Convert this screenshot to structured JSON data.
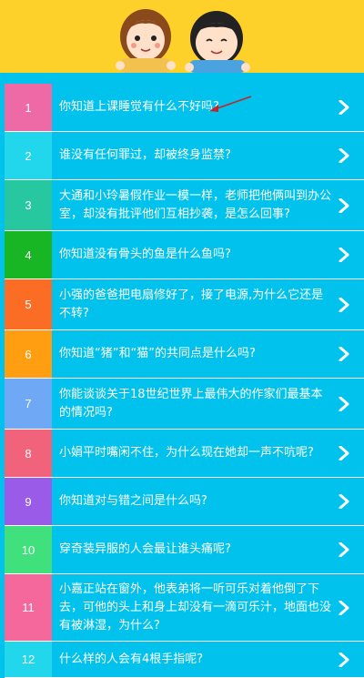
{
  "colors": {
    "background": "#00c2ec",
    "header": "#fdd02a",
    "annotation_arrow": "#c0262a"
  },
  "header": {
    "illustration": "cartoon-girl-and-boy"
  },
  "questions": [
    {
      "num": "1",
      "text": "你知道上课睡觉有什么不好吗?",
      "color": "#ee6aa7"
    },
    {
      "num": "2",
      "text": "谁没有任何罪过，却被终身监禁?",
      "color": "#22d6ec"
    },
    {
      "num": "3",
      "text": "大通和小玲暑假作业一模一样，老师把他俩叫到办公室，却没有批评他们互相抄袭，是怎么回事?",
      "color": "#27c7a0"
    },
    {
      "num": "4",
      "text": "你知道没有骨头的鱼是什么鱼吗?",
      "color": "#18b524"
    },
    {
      "num": "5",
      "text": "小强的爸爸把电扇修好了，接了电源,为什么它还是不转?",
      "color": "#fb6d25"
    },
    {
      "num": "6",
      "text": "你知道“猪”和“猫”的共同点是什么吗?",
      "color": "#ff9e10"
    },
    {
      "num": "7",
      "text": "你能谈谈关于18世纪世界上最伟大的作家们最基本的情况吗?",
      "color": "#6fa8f4"
    },
    {
      "num": "8",
      "text": "小娟平时嘴闲不住，为什么现在她却一声不吭呢?",
      "color": "#f0637a"
    },
    {
      "num": "9",
      "text": "你知道对与错之间是什么吗?",
      "color": "#9a5ce8"
    },
    {
      "num": "10",
      "text": "穿奇装异服的人会最让谁头痛呢?",
      "color": "#40e07c"
    },
    {
      "num": "11",
      "text": "小嘉正站在窗外，他表弟将一听可乐对着他倒了下去，可他的头上和身上却没有一滴可乐汁，地面也没有被淋湿，为什么?",
      "color": "#f5689c"
    },
    {
      "num": "12",
      "text": "什么样的人会有4根手指呢?",
      "color": "#22d6ec"
    }
  ]
}
